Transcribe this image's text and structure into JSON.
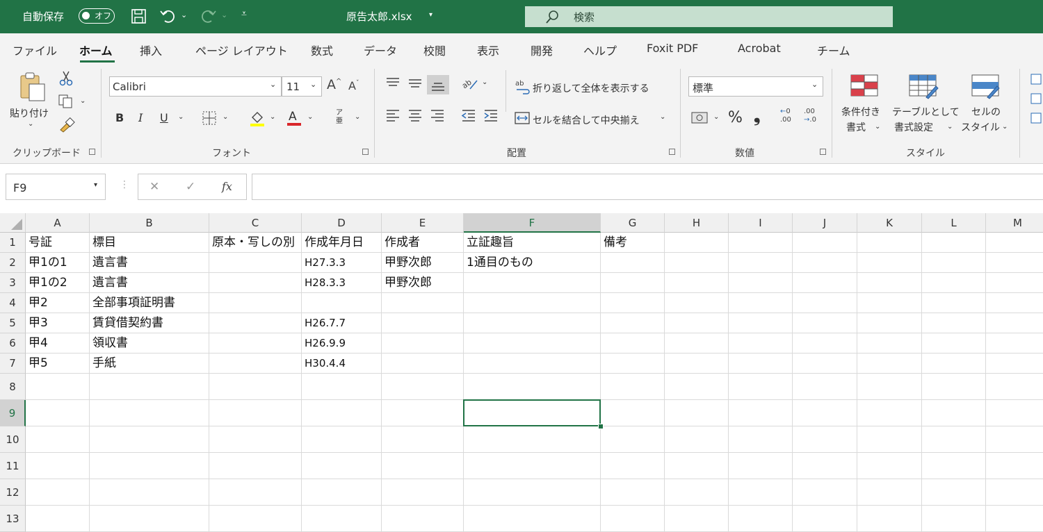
{
  "titlebar": {
    "autosave_label": "自動保存",
    "autosave_state": "オフ",
    "file_name": "原告太郎.xlsx",
    "search_placeholder": "検索"
  },
  "tabs": [
    "ファイル",
    "ホーム",
    "挿入",
    "ページ レイアウト",
    "数式",
    "データ",
    "校閲",
    "表示",
    "開発",
    "ヘルプ",
    "Foxit PDF",
    "Acrobat",
    "チーム"
  ],
  "active_tab": "ホーム",
  "ribbon": {
    "clipboard": {
      "paste_label": "貼り付け",
      "group_label": "クリップボード"
    },
    "font": {
      "font_name": "Calibri",
      "font_size": "11",
      "group_label": "フォント",
      "bold": "B",
      "italic": "I",
      "underline": "U"
    },
    "alignment": {
      "wrap_text": "折り返して全体を表示する",
      "merge_center": "セルを結合して中央揃え",
      "group_label": "配置"
    },
    "number": {
      "format": "標準",
      "percent": "%",
      "comma": "❟",
      "group_label": "数値"
    },
    "styles": {
      "conditional_l1": "条件付き",
      "conditional_l2": "書式",
      "table_l1": "テーブルとして",
      "table_l2": "書式設定",
      "cell_l1": "セルの",
      "cell_l2": "スタイル",
      "group_label": "スタイル"
    }
  },
  "formula_bar": {
    "name_box": "F9",
    "cancel": "✕",
    "enter": "✓",
    "fx": "fx",
    "formula": ""
  },
  "sheet": {
    "columns": [
      "A",
      "B",
      "C",
      "D",
      "E",
      "F",
      "G",
      "H",
      "I",
      "J",
      "K",
      "L",
      "M"
    ],
    "rows": [
      "1",
      "2",
      "3",
      "4",
      "5",
      "6",
      "7",
      "8",
      "9",
      "10",
      "11",
      "12",
      "13"
    ],
    "selected_cell": "F9",
    "cells": {
      "A1": "号証",
      "B1": "標目",
      "C1": "原本・写しの別",
      "D1": "作成年月日",
      "E1": "作成者",
      "F1": "立証趣旨",
      "G1": "備考",
      "A2": "甲1の1",
      "B2": "遺言書",
      "D2": "H27.3.3",
      "E2": "甲野次郎",
      "F2": "1通目のもの",
      "A3": "甲1の2",
      "B3": "遺言書",
      "D3": "H28.3.3",
      "E3": "甲野次郎",
      "A4": "甲2",
      "B4": "全部事項証明書",
      "A5": "甲3",
      "B5": "賃貸借契約書",
      "D5": "H26.7.7",
      "A6": "甲4",
      "B6": "領収書",
      "D6": "H26.9.9",
      "A7": "甲5",
      "B7": "手紙",
      "D7": "H30.4.4"
    }
  }
}
